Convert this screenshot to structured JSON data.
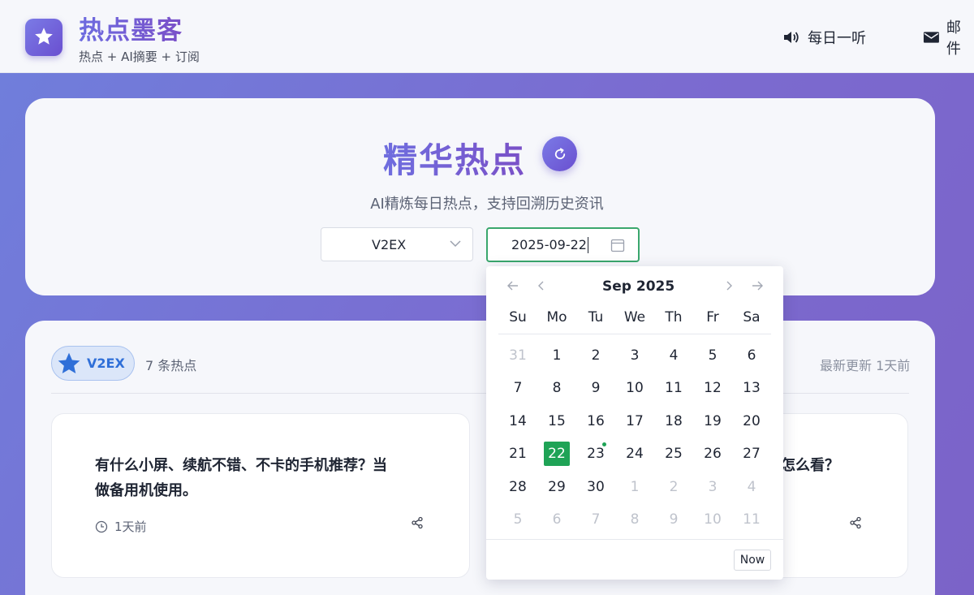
{
  "header": {
    "brand_title": "热点墨客",
    "brand_subtitle": "热点 + AI摘要 + 订阅",
    "nav": [
      {
        "label": "每日一听",
        "icon": "speaker-icon"
      },
      {
        "label": "邮件",
        "icon": "mail-icon"
      }
    ]
  },
  "hero": {
    "title": "精华热点",
    "subtitle": "AI精炼每日热点，支持回溯历史资讯",
    "source_select": "V2EX",
    "date_value": "2025-09-22"
  },
  "main": {
    "source_badge": "V2EX",
    "hot_count": "7 条热点",
    "updated": "最新更新 1天前",
    "cards": [
      {
        "title_line1": "有什么小屏、续航不错、不卡的手机推荐？当",
        "title_line2": "做备用机使用。",
        "time": "1天前"
      },
      {
        "title_partial": "怎么看？"
      }
    ]
  },
  "datepicker": {
    "month_title": "Sep 2025",
    "weekdays": [
      "Su",
      "Mo",
      "Tu",
      "We",
      "Th",
      "Fr",
      "Sa"
    ],
    "weeks": [
      [
        "31",
        "1",
        "2",
        "3",
        "4",
        "5",
        "6"
      ],
      [
        "7",
        "8",
        "9",
        "10",
        "11",
        "12",
        "13"
      ],
      [
        "14",
        "15",
        "16",
        "17",
        "18",
        "19",
        "20"
      ],
      [
        "21",
        "22",
        "23",
        "24",
        "25",
        "26",
        "27"
      ],
      [
        "28",
        "29",
        "30",
        "1",
        "2",
        "3",
        "4"
      ],
      [
        "5",
        "6",
        "7",
        "8",
        "9",
        "10",
        "11"
      ]
    ],
    "selected_day": "22",
    "today_day": "23",
    "now_label": "Now"
  },
  "colors": {
    "accent_purple": "#6d6ce0",
    "selected_green": "#1fa356",
    "badge_blue": "#2f6fd8"
  }
}
